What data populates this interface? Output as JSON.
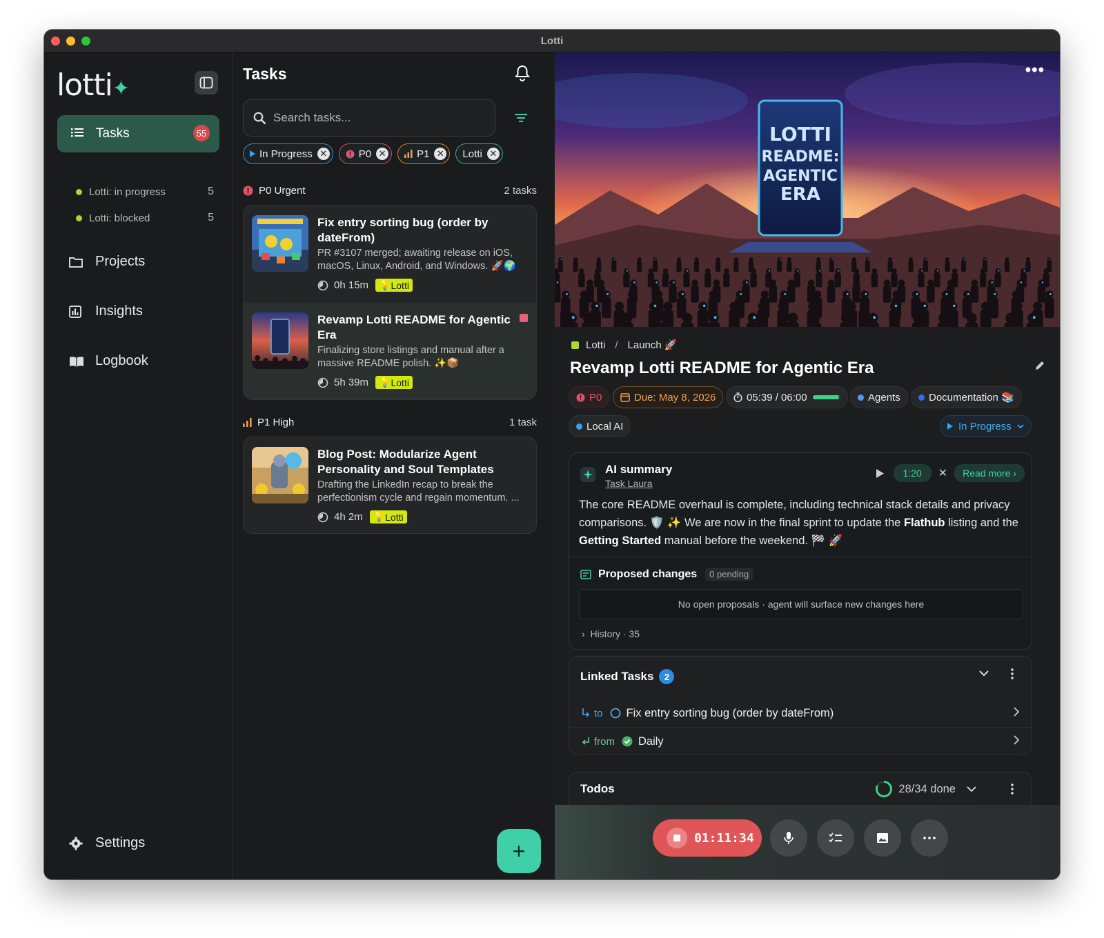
{
  "window": {
    "title": "Lotti"
  },
  "sidebar": {
    "logo": "lotti",
    "nav_active": {
      "label": "Tasks",
      "badge": "55"
    },
    "saved_filters": [
      {
        "label": "Lotti: in progress",
        "count": "5"
      },
      {
        "label": "Lotti: blocked",
        "count": "5"
      }
    ],
    "items": [
      {
        "label": "Projects"
      },
      {
        "label": "Insights"
      },
      {
        "label": "Logbook"
      }
    ],
    "settings": "Settings"
  },
  "tasks": {
    "title": "Tasks",
    "search_placeholder": "Search tasks...",
    "chips": [
      {
        "label": "In Progress",
        "color": "#3aa0e8"
      },
      {
        "label": "P0",
        "color": "#e0566a"
      },
      {
        "label": "P1",
        "color": "#f0a050"
      },
      {
        "label": "Lotti",
        "color": "#3fcfa9"
      }
    ],
    "groups": [
      {
        "label": "P0 Urgent",
        "count": "2 tasks"
      },
      {
        "label": "P1 High",
        "count": "1 task"
      }
    ],
    "cards": [
      {
        "title": "Fix entry sorting bug (order by dateFrom)",
        "desc": "PR #3107 merged; awaiting release on iOS, macOS, Linux, Android, and Windows. 🚀🌍",
        "time": "0h 15m",
        "tag": "Lotti"
      },
      {
        "title": "Revamp Lotti README for Agentic Era",
        "desc": "Finalizing store listings and manual after a massive README polish. ✨📦",
        "time": "5h 39m",
        "tag": "Lotti"
      },
      {
        "title": "Blog Post: Modularize Agent Personality and Soul Templates",
        "desc": "Drafting the LinkedIn recap to break the perfectionism cycle and regain momentum. ...",
        "time": "4h 2m",
        "tag": "Lotti"
      }
    ]
  },
  "detail": {
    "hero_text": [
      "LOTTI",
      "README:",
      "AGENTIC",
      "ERA"
    ],
    "breadcrumb": {
      "project": "Lotti",
      "sep": "/",
      "section": "Launch 🚀"
    },
    "title": "Revamp Lotti README for Agentic Era",
    "pills": {
      "priority": "P0",
      "due": "Due: May 8, 2026",
      "time": "05:39 / 06:00",
      "time_progress": 0.94,
      "labels": [
        {
          "label": "Agents",
          "color": "#4a9ff0"
        },
        {
          "label": "Documentation 📚",
          "color": "#2f6fe0"
        },
        {
          "label": "Local AI",
          "color": "#3aa0e8"
        }
      ],
      "status": "In Progress"
    },
    "ai_summary": {
      "title": "AI summary",
      "subtitle": "Task Laura",
      "speed": "1:20",
      "read_more": "Read more",
      "text_parts": {
        "p1": "The core README overhaul is complete, including technical stack details and privacy comparisons. 🛡️ ✨  We are now in the final sprint to update the ",
        "b1": "Flathub",
        "p2": " listing and the ",
        "b2": "Getting Started",
        "p3": " manual before the weekend. 🏁 🚀"
      },
      "proposed_title": "Proposed changes",
      "pending": "0 pending",
      "no_proposals": "No open proposals · agent will surface new changes here",
      "history": "History · 35"
    },
    "linked_tasks": {
      "title": "Linked Tasks",
      "count": "2",
      "rows": [
        {
          "dir": "to",
          "label": "Fix entry sorting bug (order by dateFrom)"
        },
        {
          "dir": "from",
          "label": "Daily"
        }
      ]
    },
    "todos": {
      "title": "Todos",
      "progress": "28/34 done",
      "done_fraction": 0.82
    },
    "recorder": {
      "time": "01:11:34"
    }
  }
}
